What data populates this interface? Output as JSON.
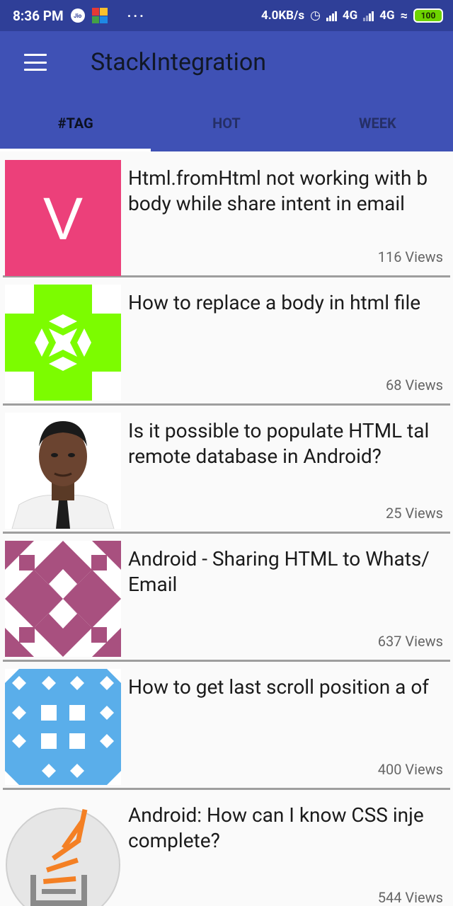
{
  "status_bar": {
    "time": "8:36 PM",
    "jio_label": "Jio",
    "dots": "···",
    "speed": "4.0KB/s",
    "network1": "4G",
    "network2": "4G",
    "battery": "100"
  },
  "app": {
    "title": "StackIntegration"
  },
  "tabs": [
    {
      "label": "#TAG",
      "active": true
    },
    {
      "label": "HOT",
      "active": false
    },
    {
      "label": "WEEK",
      "active": false
    }
  ],
  "questions": [
    {
      "title": "Html.fromHtml not working with body while share intent in email",
      "title_display": "Html.fromHtml not working with b body while share intent in email",
      "views": "116 Views",
      "avatar": "letter-v-avatar",
      "avatar_letter": "V",
      "avatar_color": "#ec407a"
    },
    {
      "title": "How to replace a body in html file",
      "title_display": "How to replace a body in html file",
      "views": "68 Views",
      "avatar": "identicon-green",
      "avatar_color": "#7cfc00"
    },
    {
      "title": "Is it possible to populate HTML table remote database in Android?",
      "title_display": "Is it possible to populate HTML tal remote database in Android?",
      "views": "25 Views",
      "avatar": "user-photo"
    },
    {
      "title": "Android - Sharing HTML to WhatsApp Email",
      "title_display": "Android - Sharing HTML to Whats/ Email",
      "views": "637 Views",
      "avatar": "identicon-purple",
      "avatar_color": "#a8507f"
    },
    {
      "title": "How to get last scroll position a of",
      "title_display": "How to get last scroll position a of",
      "views": "400 Views",
      "avatar": "identicon-blue",
      "avatar_color": "#5aaeea"
    },
    {
      "title": "Android: How can I know CSS injection complete?",
      "title_display": "Android: How can I know CSS inje complete?",
      "views": "544 Views",
      "avatar": "stackoverflow-logo"
    }
  ]
}
